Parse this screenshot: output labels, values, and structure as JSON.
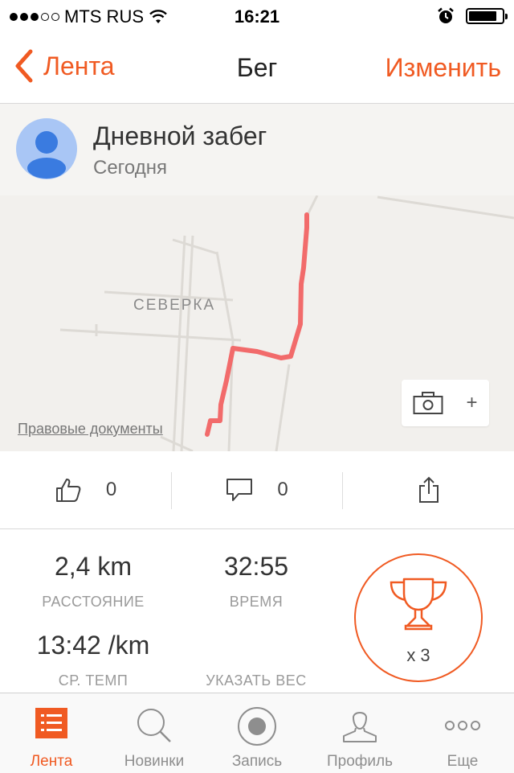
{
  "status_bar": {
    "carrier": "MTS RUS",
    "time": "16:21"
  },
  "nav": {
    "back_label": "Лента",
    "title": "Бег",
    "edit_label": "Изменить"
  },
  "activity": {
    "title": "Дневной забег",
    "date": "Сегодня"
  },
  "map": {
    "place_label": "СЕВЕРКА",
    "legal_link": "Правовые документы",
    "add_photo_plus": "+"
  },
  "social": {
    "likes": "0",
    "comments": "0"
  },
  "stats": {
    "distance_value": "2,4 km",
    "distance_label": "РАССТОЯНИЕ",
    "time_value": "32:55",
    "time_label": "ВРЕМЯ",
    "pace_value": "13:42 /km",
    "pace_label": "СР. ТЕМП",
    "weight_label": "УКАЗАТЬ ВЕС",
    "achievements_count": "x 3"
  },
  "tabs": [
    {
      "label": "Лента",
      "icon": "feed-list-icon"
    },
    {
      "label": "Новинки",
      "icon": "search-icon"
    },
    {
      "label": "Запись",
      "icon": "record-icon"
    },
    {
      "label": "Профиль",
      "icon": "profile-icon"
    },
    {
      "label": "Еще",
      "icon": "more-icon"
    }
  ],
  "colors": {
    "accent": "#f05a22",
    "route": "#f26b6b",
    "map_bg": "#f2f0ed"
  }
}
